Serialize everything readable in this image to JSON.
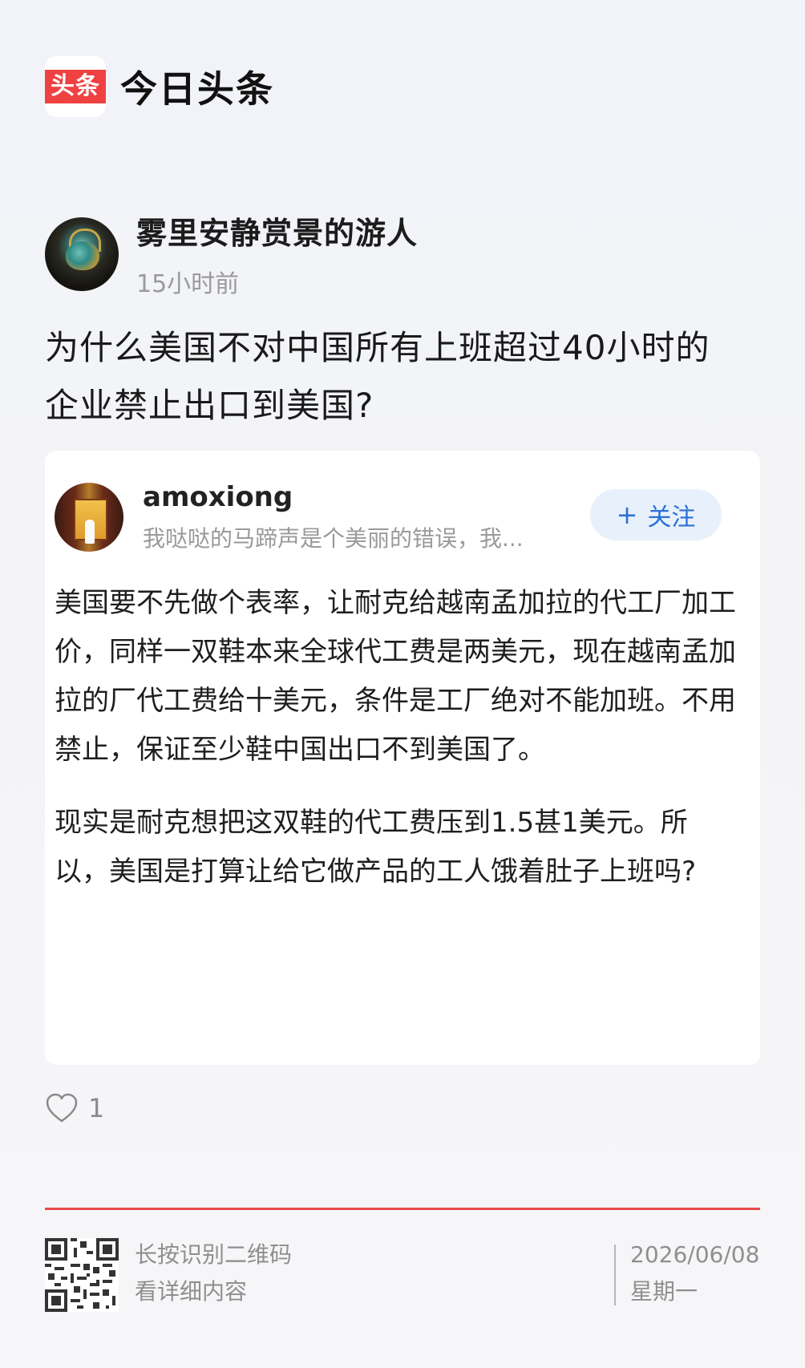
{
  "app": {
    "logo_text": "头条",
    "name": "今日头条"
  },
  "author": {
    "name": "雾里安静赏景的游人",
    "time": "15小时前"
  },
  "post": {
    "title_lines": [
      "为什么美国不对中国所有上班超过40小时的",
      "企业禁止出口到美国?"
    ]
  },
  "answer": {
    "user": "amoxiong",
    "signature": "我哒哒的马蹄声是个美丽的错误，我...",
    "follow_label": "关注",
    "follow_icon": "plus-icon",
    "paragraphs": [
      "美国要不先做个表率，让耐克给越南孟加拉的代工厂加工价，同样一双鞋本来全球代工费是两美元，现在越南孟加拉的厂代工费给十美元，条件是工厂绝对不能加班。不用禁止，保证至少鞋中国出口不到美国了。",
      "现实是耐克想把这双鞋的代工费压到1.5甚1美元。所以，美国是打算让给它做产品的工人饿着肚子上班吗?"
    ]
  },
  "likes": {
    "icon": "heart-icon",
    "count": "1"
  },
  "footer": {
    "scan_line1": "长按识别二维码",
    "scan_line2": "看详细内容",
    "date": "2026/06/08",
    "weekday": "星期一"
  },
  "colors": {
    "brand_red": "#f04142",
    "follow_blue": "#2b6fd6",
    "divider_red": "#e8484a"
  }
}
